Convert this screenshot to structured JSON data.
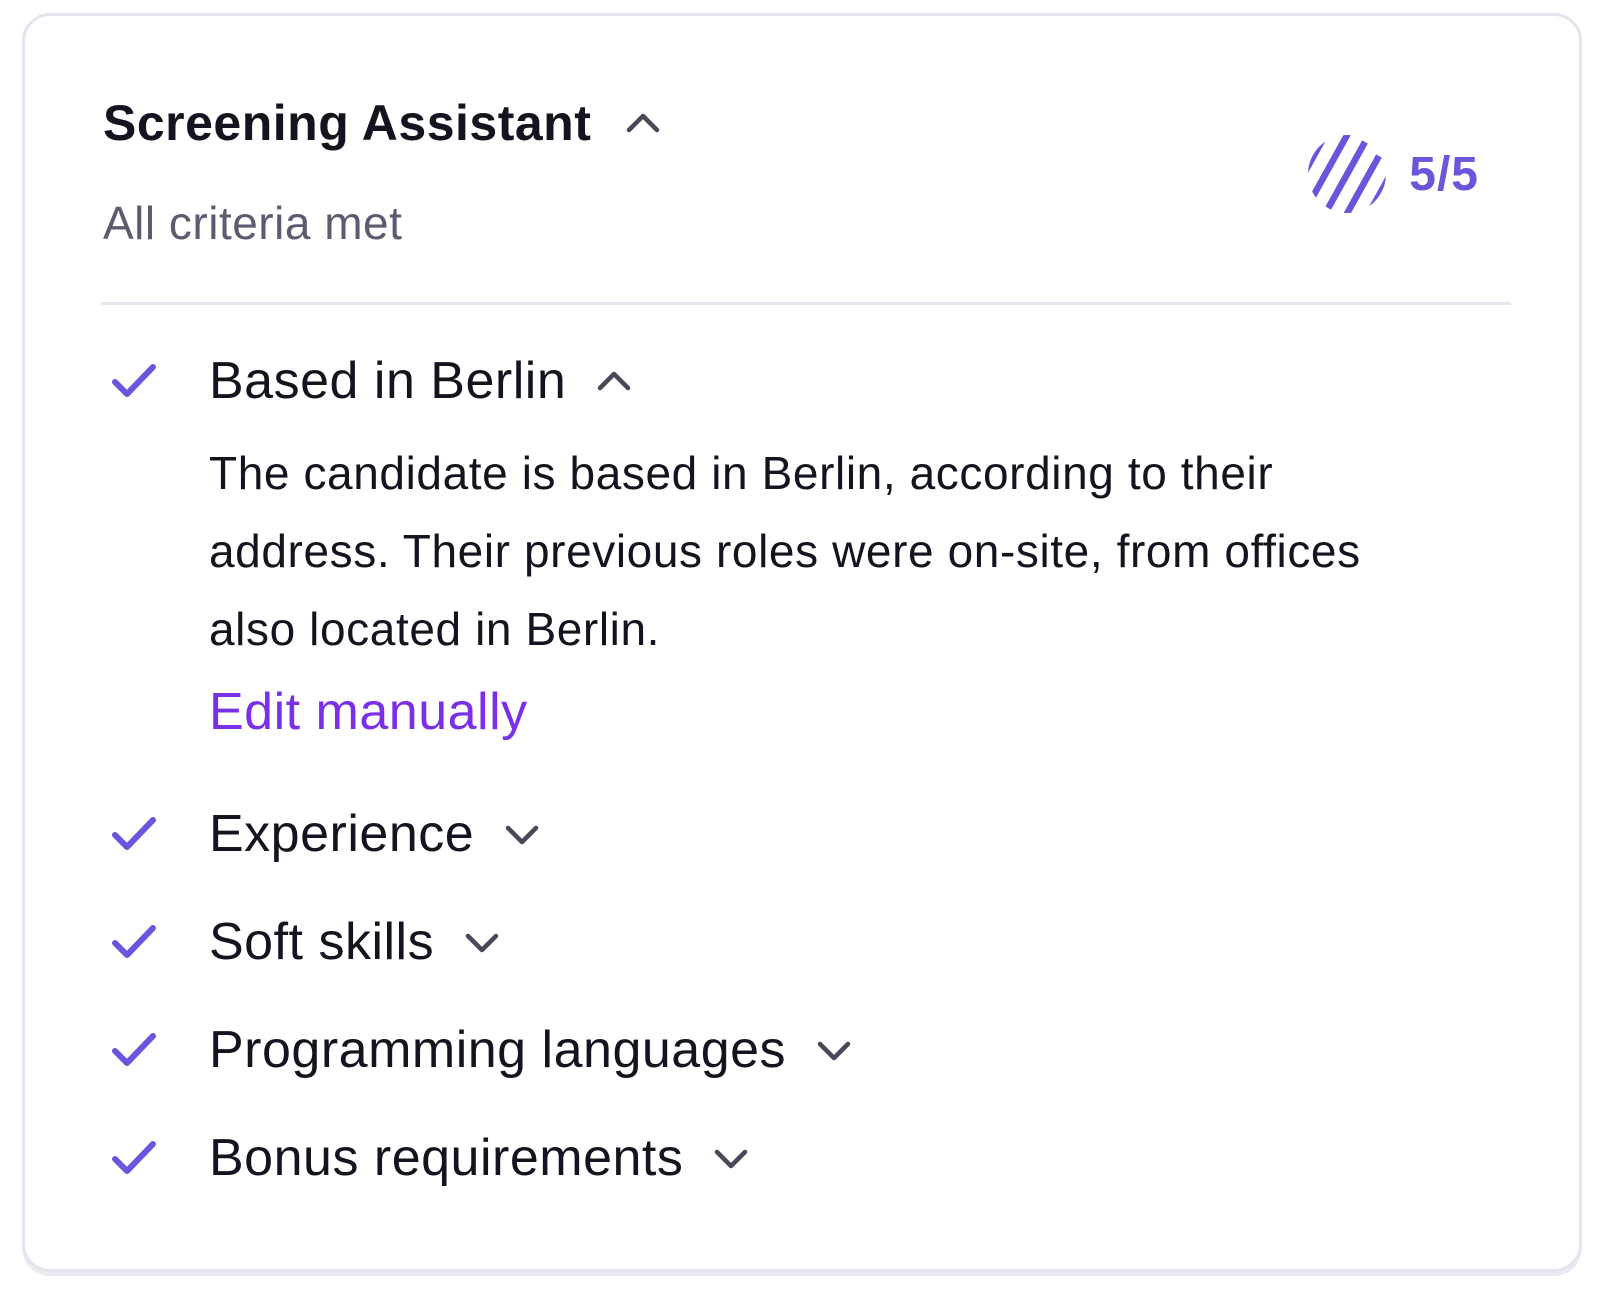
{
  "header": {
    "title": "Screening Assistant",
    "subtitle": "All criteria met",
    "score": "5/5"
  },
  "criteria": [
    {
      "label": "Based in Berlin",
      "expanded": true,
      "met": true,
      "description": "The candidate is based in Berlin, according to their address. Their previous roles were on-site, from offices also located in Berlin.",
      "action": "Edit manually"
    },
    {
      "label": "Experience",
      "expanded": false,
      "met": true
    },
    {
      "label": "Soft skills",
      "expanded": false,
      "met": true
    },
    {
      "label": "Programming languages",
      "expanded": false,
      "met": true
    },
    {
      "label": "Bonus requirements",
      "expanded": false,
      "met": true
    }
  ],
  "colors": {
    "accent": "#6b55dc",
    "link": "#7a2fe8",
    "text": "#15131f",
    "muted": "#5d5b70"
  },
  "icons": {
    "check": "check-icon",
    "chevron_up": "chevron-up-icon",
    "chevron_down": "chevron-down-icon",
    "score": "striped-circle-icon"
  }
}
